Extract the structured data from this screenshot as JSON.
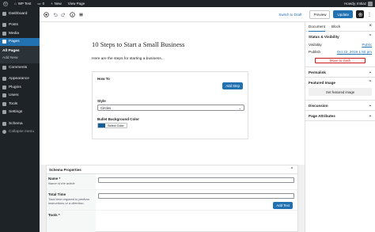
{
  "adminbar": {
    "site_name": "WP Test",
    "comments_count": "0",
    "new_label": "New",
    "view_page_label": "View Page",
    "howdy_label": "Howdy, Imtiaz"
  },
  "sidebar": {
    "items": [
      {
        "label": "Dashboard",
        "icon": "dashboard-icon"
      },
      {
        "label": "Posts",
        "icon": "pin-icon"
      },
      {
        "label": "Media",
        "icon": "media-icon"
      },
      {
        "label": "Pages",
        "icon": "pages-icon"
      },
      {
        "label": "Comments",
        "icon": "comment-icon"
      },
      {
        "label": "Appearance",
        "icon": "brush-icon"
      },
      {
        "label": "Plugins",
        "icon": "plugin-icon"
      },
      {
        "label": "Users",
        "icon": "users-icon"
      },
      {
        "label": "Tools",
        "icon": "wrench-icon"
      },
      {
        "label": "Settings",
        "icon": "settings-icon"
      },
      {
        "label": "Schema",
        "icon": "schema-icon"
      },
      {
        "label": "Collapse menu",
        "icon": "collapse-icon"
      }
    ],
    "submenu": [
      "All Pages",
      "Add New"
    ],
    "active_color": "#2271b1"
  },
  "header": {
    "switch_to_draft": "Switch to Draft",
    "preview": "Preview",
    "update": "Update"
  },
  "post": {
    "title": "10 Steps to Start a Small Business",
    "intro": "Here are the steps for starting a business..."
  },
  "howto_block": {
    "label": "How To",
    "add_step": "Add Step",
    "style_label": "Style",
    "style_value": "Circles",
    "bullet_label": "Bullet Background Color",
    "select_color": "Select Color",
    "swatch_color": "#135e96"
  },
  "schema_metabox": {
    "title": "Schema Properties",
    "rows": [
      {
        "label": "Name *",
        "hint": "Name of the article"
      },
      {
        "label": "Total Time",
        "hint": "Total time required to perform instructions or a direction."
      },
      {
        "label": "Tools *",
        "hint": ""
      }
    ],
    "add_text": "Add Text"
  },
  "settings": {
    "tabs": [
      "Document",
      "Block"
    ],
    "status_visibility": "Status & Visibility",
    "visibility_label": "Visibility",
    "visibility_value": "Public",
    "publish_label": "Publish",
    "publish_value": "Oct 22, 2019 1:50 pm",
    "move_to_trash": "Move to trash",
    "permalink": "Permalink",
    "featured_image": "Featured Image",
    "set_featured_image": "Set featured image",
    "discussion": "Discussion",
    "page_attributes": "Page Attributes"
  }
}
